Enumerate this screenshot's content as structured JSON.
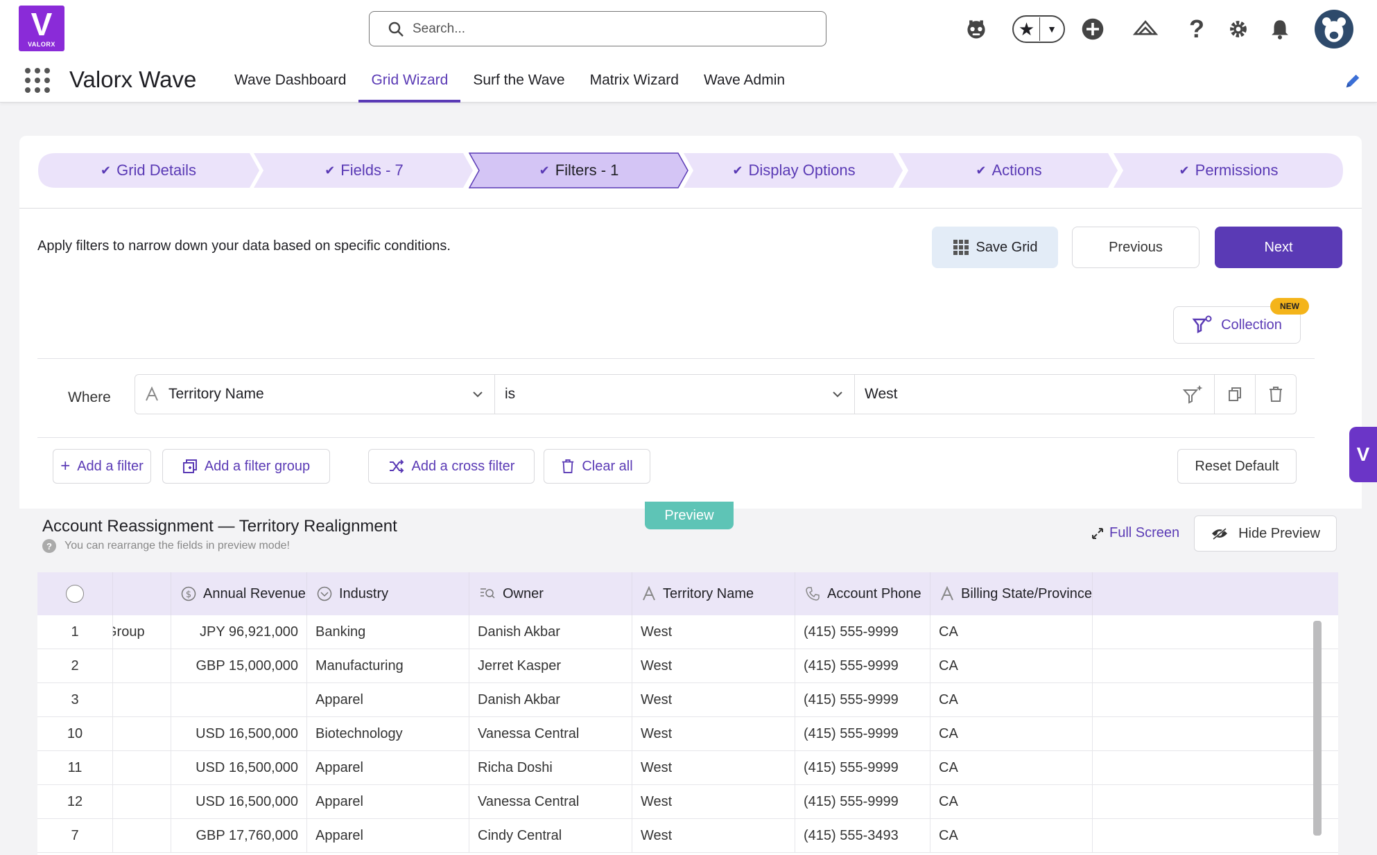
{
  "brand": {
    "logo_letter": "V",
    "logo_text": "VALORX",
    "app_name": "Valorx Wave"
  },
  "search": {
    "placeholder": "Search..."
  },
  "nav": {
    "tabs": [
      "Wave Dashboard",
      "Grid Wizard",
      "Surf the Wave",
      "Matrix Wizard",
      "Wave Admin"
    ],
    "active": "Grid Wizard"
  },
  "header_icons": [
    "agent-icon",
    "favorites-star-icon",
    "add-icon",
    "trailhead-icon",
    "help-icon",
    "setup-gear-icon",
    "notifications-bell-icon",
    "user-avatar"
  ],
  "steps": [
    {
      "label": "Grid Details",
      "active": false
    },
    {
      "label": "Fields - 7",
      "active": false
    },
    {
      "label": "Filters - 1",
      "active": true
    },
    {
      "label": "Display Options",
      "active": false
    },
    {
      "label": "Actions",
      "active": false
    },
    {
      "label": "Permissions",
      "active": false
    }
  ],
  "page": {
    "description": "Apply filters to narrow down your data based on specific conditions.",
    "save_label": "Save Grid",
    "previous_label": "Previous",
    "next_label": "Next",
    "collection_label": "Collection",
    "new_badge": "NEW"
  },
  "filter": {
    "where_label": "Where",
    "field": "Territory Name",
    "operator": "is",
    "value": "West"
  },
  "filter_actions": {
    "add_filter": "Add a filter",
    "add_group": "Add a filter group",
    "add_cross": "Add a cross filter",
    "clear_all": "Clear all",
    "reset_default": "Reset Default"
  },
  "preview": {
    "tab_label": "Preview",
    "title": "Account Reassignment — Territory Realignment",
    "subtitle": "You can rearrange the fields in preview mode!",
    "full_screen": "Full Screen",
    "hide_preview": "Hide Preview"
  },
  "grid": {
    "columns": [
      "",
      "Annual Revenue",
      "Industry",
      "Owner",
      "Territory Name",
      "Account Phone",
      "Billing State/Province"
    ],
    "rows": [
      {
        "n": "1",
        "partial": "Group",
        "revenue": "JPY 96,921,000",
        "industry": "Banking",
        "owner": "Danish Akbar",
        "territory": "West",
        "phone": "(415) 555-9999",
        "state": "CA"
      },
      {
        "n": "2",
        "partial": "",
        "revenue": "GBP 15,000,000",
        "industry": "Manufacturing",
        "owner": "Jerret Kasper",
        "territory": "West",
        "phone": "(415) 555-9999",
        "state": "CA"
      },
      {
        "n": "3",
        "partial": "",
        "revenue": "",
        "industry": "Apparel",
        "owner": "Danish Akbar",
        "territory": "West",
        "phone": "(415) 555-9999",
        "state": "CA"
      },
      {
        "n": "10",
        "partial": "",
        "revenue": "USD 16,500,000",
        "industry": "Biotechnology",
        "owner": "Vanessa Central",
        "territory": "West",
        "phone": "(415) 555-9999",
        "state": "CA"
      },
      {
        "n": "11",
        "partial": "",
        "revenue": "USD 16,500,000",
        "industry": "Apparel",
        "owner": "Richa Doshi",
        "territory": "West",
        "phone": "(415) 555-9999",
        "state": "CA"
      },
      {
        "n": "12",
        "partial": "",
        "revenue": "USD 16,500,000",
        "industry": "Apparel",
        "owner": "Vanessa Central",
        "territory": "West",
        "phone": "(415) 555-9999",
        "state": "CA"
      },
      {
        "n": "7",
        "partial": "",
        "revenue": "GBP 17,760,000",
        "industry": "Apparel",
        "owner": "Cindy Central",
        "territory": "West",
        "phone": "(415) 555-3493",
        "state": "CA"
      }
    ]
  },
  "colors": {
    "accent": "#5a3ab5",
    "step_bg": "#ebe3fa",
    "step_active": "#d4c5f5",
    "preview_tab": "#5ec4b6",
    "brand": "#8a2bd8",
    "new_badge": "#f4b41a"
  }
}
